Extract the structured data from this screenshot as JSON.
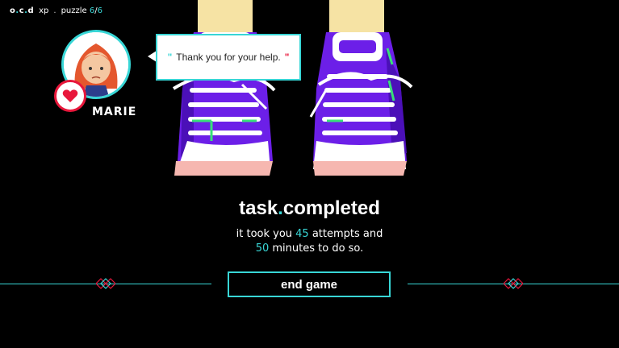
{
  "hud": {
    "logo_a": "o",
    "logo_b": "c",
    "logo_c": "d",
    "xp": "xp",
    "separator": ".",
    "puzzle_label": "puzzle",
    "puzzle_current": "6",
    "puzzle_total": "6"
  },
  "character": {
    "name": "MARIE",
    "portrait_icon": "marie-portrait",
    "status_icon": "heart-icon"
  },
  "dialogue": {
    "open_quote": "\"",
    "text": "Thank you for your help.",
    "close_quote": "\""
  },
  "result": {
    "title_a": "task",
    "title_dot": ".",
    "title_b": "completed",
    "line1_pre": "it took you ",
    "attempts": "45",
    "line1_post": " attempts and",
    "minutes": "50",
    "line2_post": " minutes to do so."
  },
  "actions": {
    "end_game_label": "end game"
  },
  "colors": {
    "accent": "#38d6d6",
    "heart": "#e8173b",
    "shoe": "#6c1fe8",
    "sole": "#f6b7b0"
  }
}
